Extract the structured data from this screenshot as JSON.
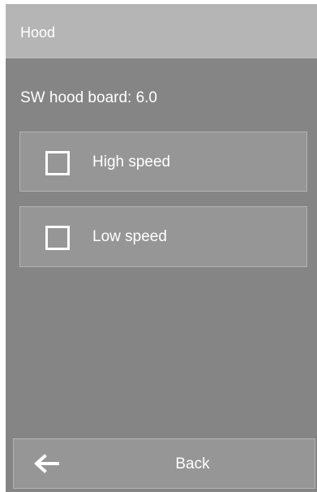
{
  "header": {
    "title": "Hood"
  },
  "info": {
    "sw_version": "SW hood board: 6.0"
  },
  "options": [
    {
      "label": "High speed",
      "checked": false
    },
    {
      "label": "Low speed",
      "checked": false
    }
  ],
  "footer": {
    "back_label": "Back",
    "back_icon": "arrow-left-icon"
  },
  "colors": {
    "background": "#858585",
    "titlebar": "#b5b5b5",
    "button": "#969696",
    "text": "#ffffff"
  }
}
